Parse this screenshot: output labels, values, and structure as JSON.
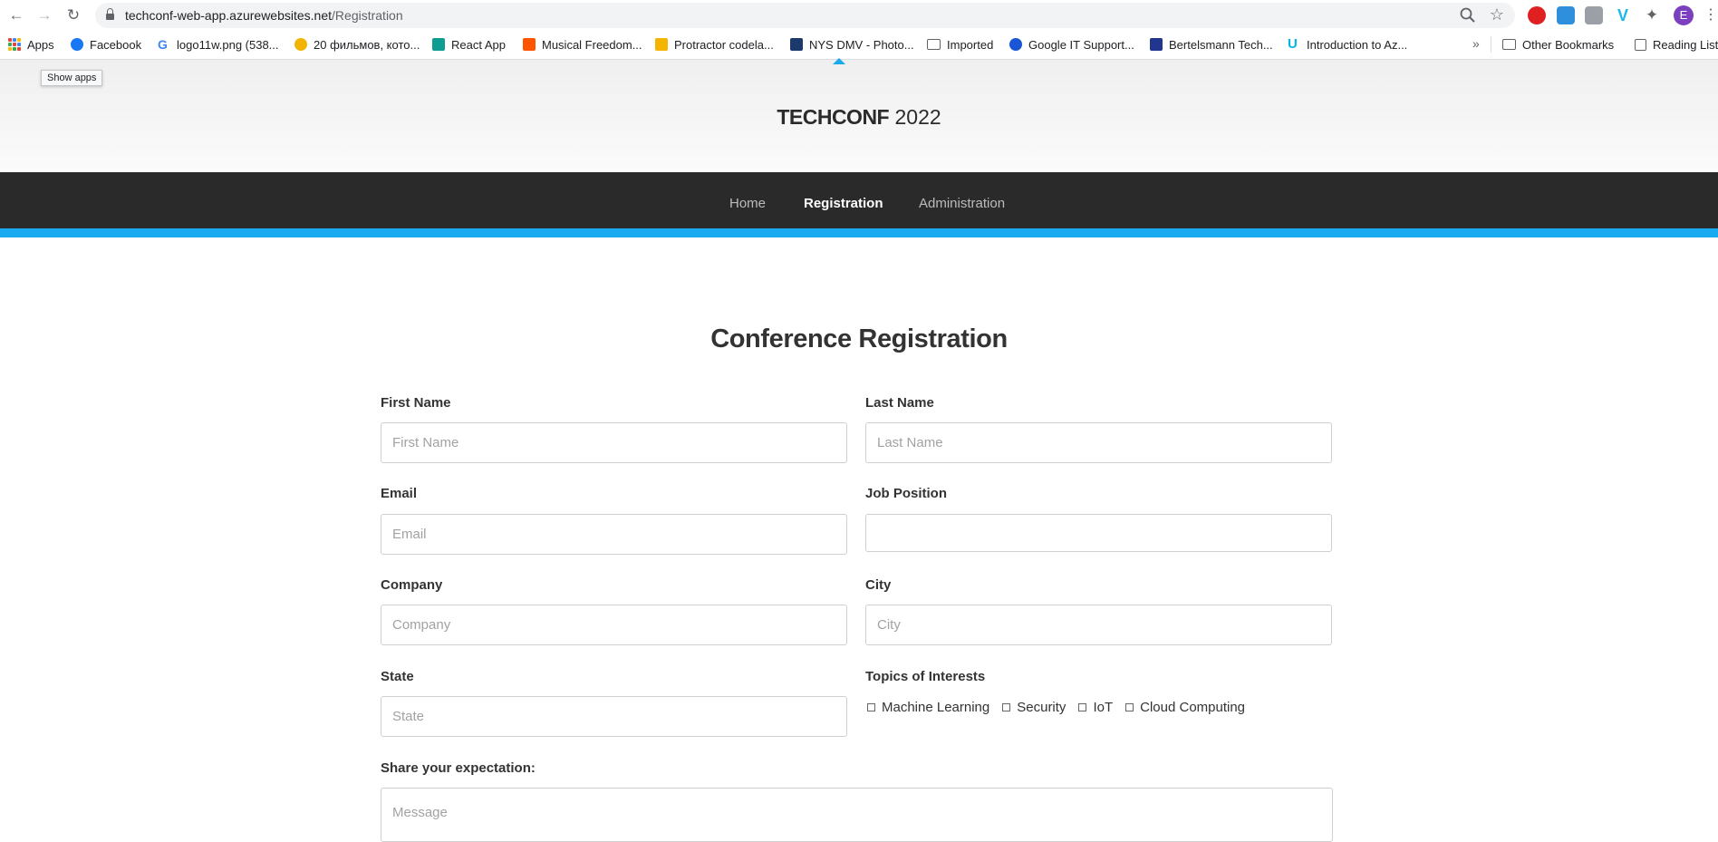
{
  "browser": {
    "url_host": "techconf-web-app.azurewebsites.net",
    "url_path": "/Registration",
    "profile_initial": "E",
    "tooltip": "Show apps",
    "bookmarks": [
      {
        "label": "Apps"
      },
      {
        "label": "Facebook"
      },
      {
        "label": "logo11w.png (538..."
      },
      {
        "label": "20 фильмов, кото..."
      },
      {
        "label": "React App"
      },
      {
        "label": "Musical Freedom..."
      },
      {
        "label": "Protractor codela..."
      },
      {
        "label": "NYS DMV - Photo..."
      },
      {
        "label": "Imported"
      },
      {
        "label": "Google IT Support..."
      },
      {
        "label": "Bertelsmann Tech..."
      },
      {
        "label": "Introduction to Az..."
      },
      {
        "label": "Other Bookmarks"
      },
      {
        "label": "Reading List"
      }
    ],
    "overflow": "»"
  },
  "site": {
    "brand_bold": "TECHCONF",
    "brand_year": "2022",
    "nav": [
      "Home",
      "Registration",
      "Administration"
    ],
    "active_nav": "Registration",
    "accent": "#1aaaf0"
  },
  "form": {
    "title": "Conference Registration",
    "first_name": {
      "label": "First Name",
      "placeholder": "First Name",
      "value": ""
    },
    "last_name": {
      "label": "Last Name",
      "placeholder": "Last Name",
      "value": ""
    },
    "email": {
      "label": "Email",
      "placeholder": "Email",
      "value": ""
    },
    "job_position": {
      "label": "Job Position",
      "placeholder": "",
      "value": ""
    },
    "company": {
      "label": "Company",
      "placeholder": "Company",
      "value": ""
    },
    "city": {
      "label": "City",
      "placeholder": "City",
      "value": ""
    },
    "state": {
      "label": "State",
      "placeholder": "State",
      "value": ""
    },
    "topics": {
      "label": "Topics of Interests",
      "options": [
        {
          "label": "Machine Learning",
          "checked": false
        },
        {
          "label": "Security",
          "checked": false
        },
        {
          "label": "IoT",
          "checked": false
        },
        {
          "label": "Cloud Computing",
          "checked": false
        }
      ]
    },
    "message": {
      "label": "Share your expectation:",
      "placeholder": "Message"
    }
  }
}
